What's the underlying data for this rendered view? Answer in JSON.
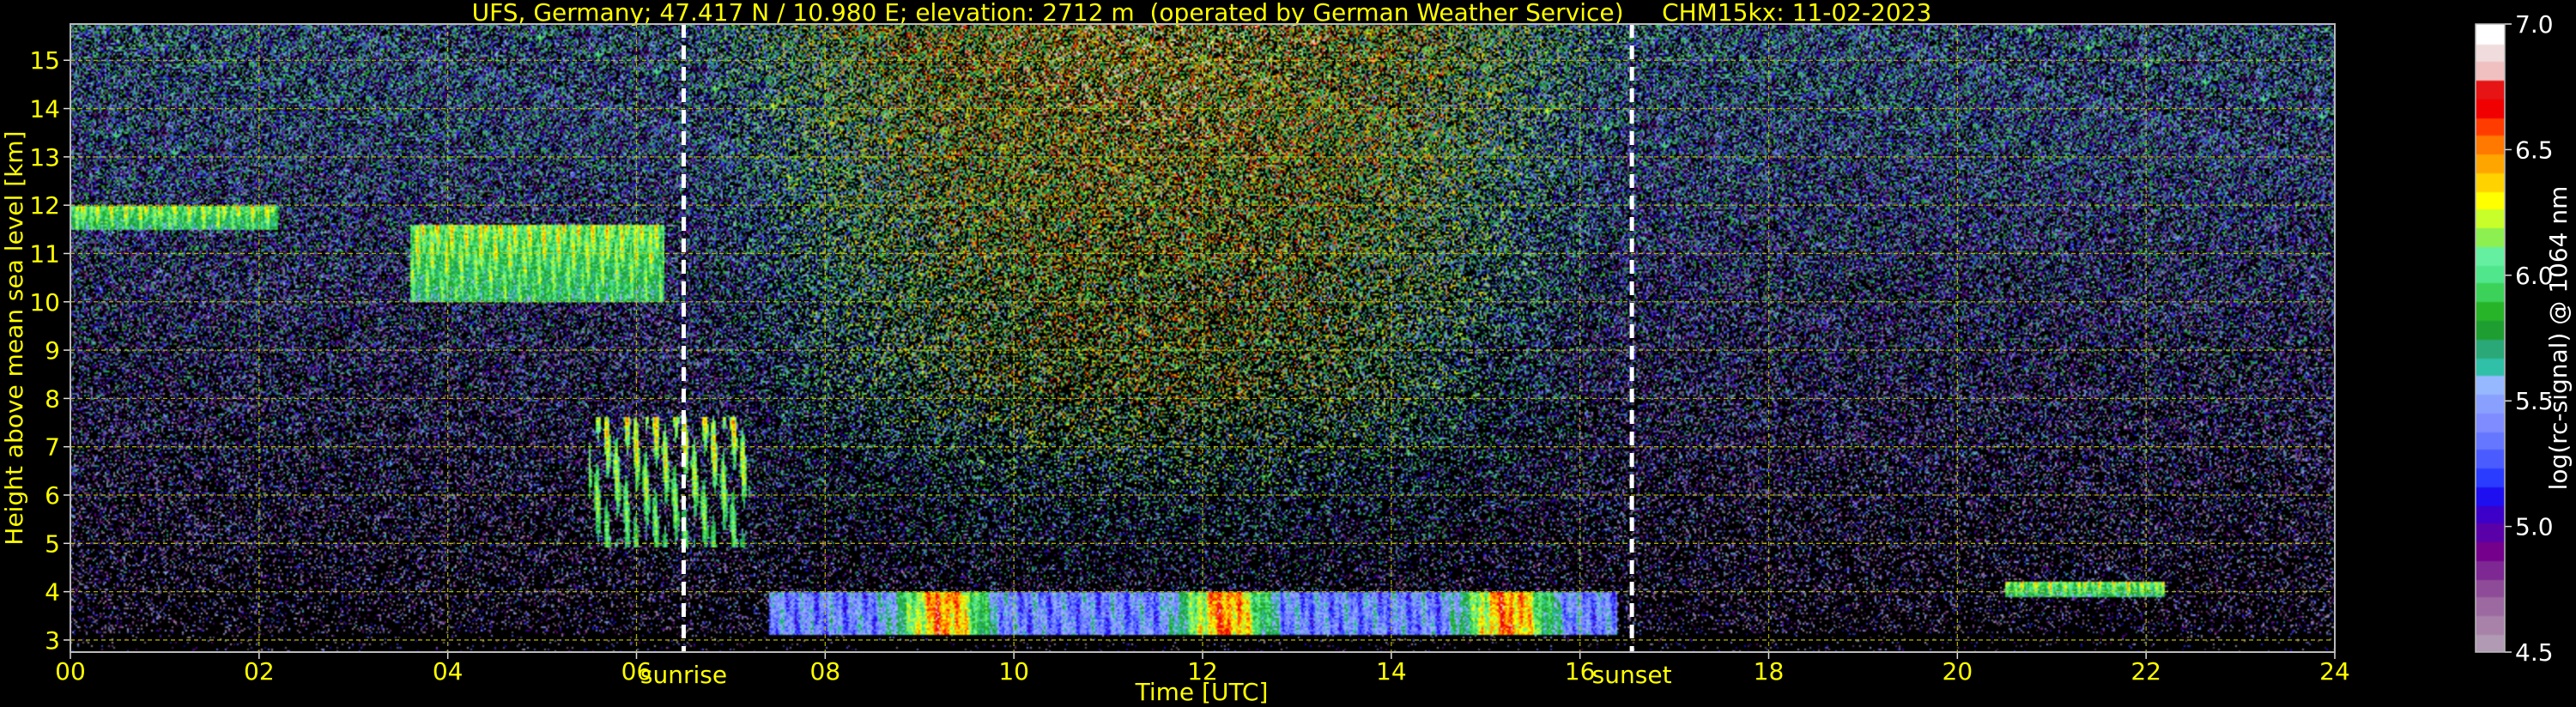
{
  "chart_data": {
    "type": "heatmap",
    "title": "UFS, Germany; 47.417 N / 10.980 E; elevation: 2712 m  (operated by German Weather Service)     CHM15kx: 11-02-2023",
    "xlabel": "Time [UTC]",
    "ylabel": "Height above mean sea level [km]",
    "xlim": [
      0,
      24
    ],
    "ylim": [
      2.75,
      15.75
    ],
    "x_ticks": [
      "00",
      "02",
      "04",
      "06",
      "08",
      "10",
      "12",
      "14",
      "16",
      "18",
      "20",
      "22",
      "24"
    ],
    "y_ticks": [
      "3",
      "4",
      "5",
      "6",
      "7",
      "8",
      "9",
      "10",
      "11",
      "12",
      "13",
      "14",
      "15"
    ],
    "grid": true,
    "colors": {
      "background": "#000000",
      "text": "#ffff00",
      "grid": "#c8c800",
      "colorbar_text": "#ffffff"
    },
    "events": [
      {
        "label": "sunrise",
        "time_utc": 6.5
      },
      {
        "label": "sunset",
        "time_utc": 16.55
      }
    ],
    "colorbar": {
      "label": "log(rc-signal) @ 1064 nm",
      "range": [
        4.5,
        7.0
      ],
      "ticks": [
        "4.5",
        "5.0",
        "5.5",
        "6.0",
        "6.5",
        "7.0"
      ],
      "colors": [
        "#b09ab4",
        "#a882a8",
        "#9c6aa0",
        "#8e4c98",
        "#7e2894",
        "#74008c",
        "#5a00a8",
        "#3c00c8",
        "#1e0ff0",
        "#2a3cff",
        "#4b5cff",
        "#6677ff",
        "#7f8cff",
        "#8aa0ff",
        "#96b8ff",
        "#30c0a8",
        "#2aa878",
        "#1e9e30",
        "#28b428",
        "#3cd25a",
        "#50e68c",
        "#64f0a0",
        "#8cf050",
        "#c8ff2a",
        "#ffff00",
        "#ffd200",
        "#ffa500",
        "#ff7800",
        "#ff3c00",
        "#f00000",
        "#e61414",
        "#f0c0c0",
        "#f0dcdc",
        "#ffffff"
      ]
    },
    "features": [
      {
        "type": "cirrus",
        "t_start": 0.0,
        "t_end": 2.2,
        "h_bottom": 11.5,
        "h_top": 12.0
      },
      {
        "type": "cirrus",
        "t_start": 3.6,
        "t_end": 6.3,
        "h_bottom": 10.0,
        "h_top": 11.6
      },
      {
        "type": "fallstreaks",
        "t_start": 5.5,
        "t_end": 7.2,
        "h_bottom": 4.9,
        "h_top": 7.6
      },
      {
        "type": "boundary_layer",
        "t_start": 7.4,
        "t_end": 16.4,
        "h_bottom": 3.1,
        "h_top": 4.0
      },
      {
        "type": "low_layer",
        "t_start": 20.5,
        "t_end": 22.2,
        "h_bottom": 3.9,
        "h_top": 4.2
      }
    ]
  }
}
